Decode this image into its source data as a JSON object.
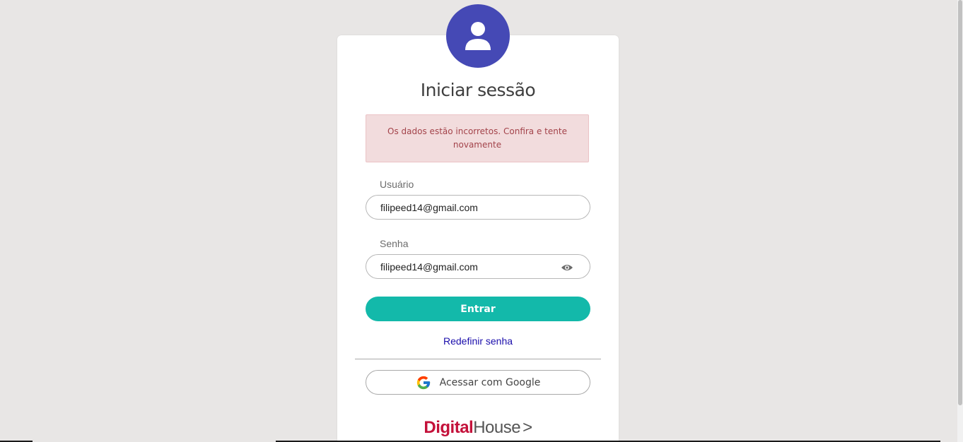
{
  "login": {
    "title": "Iniciar sessão",
    "error_message": "Os dados estão incorretos. Confira e tente novamente",
    "user_label": "Usuário",
    "user_value": "filipeed14@gmail.com",
    "password_label": "Senha",
    "password_value": "filipeed14@gmail.com",
    "submit_label": "Entrar",
    "reset_password_label": "Redefinir senha",
    "google_label": "Acessar com Google"
  },
  "brand": {
    "name_part1": "Digital",
    "name_part2": "House",
    "arrow": ">"
  },
  "colors": {
    "avatar_bg": "#4549b5",
    "primary_button": "#13b9aa",
    "error_bg": "#f2dcdd",
    "error_text": "#a3434a",
    "link": "#1a0dab",
    "brand_red": "#c4113a"
  },
  "icons": {
    "avatar": "user-icon",
    "password_toggle": "eye-icon",
    "google": "google-logo-icon"
  }
}
